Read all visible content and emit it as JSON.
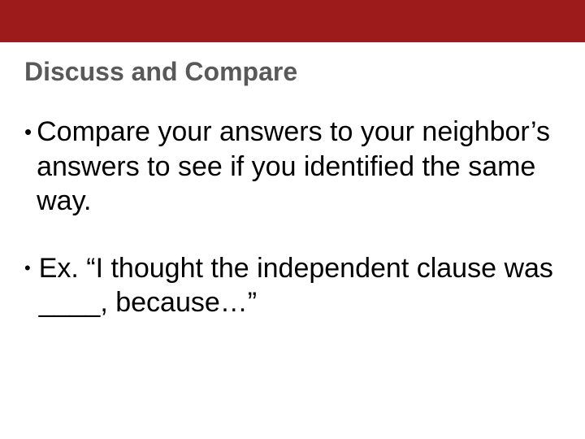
{
  "header": {},
  "title": "Discuss and Compare",
  "bullets": [
    {
      "marker": "•",
      "text": "Compare your answers to your neighbor’s answers to see if you identified the same way."
    },
    {
      "marker": "•",
      "text": " Ex. “I thought the independent clause was ____, because…”"
    }
  ]
}
